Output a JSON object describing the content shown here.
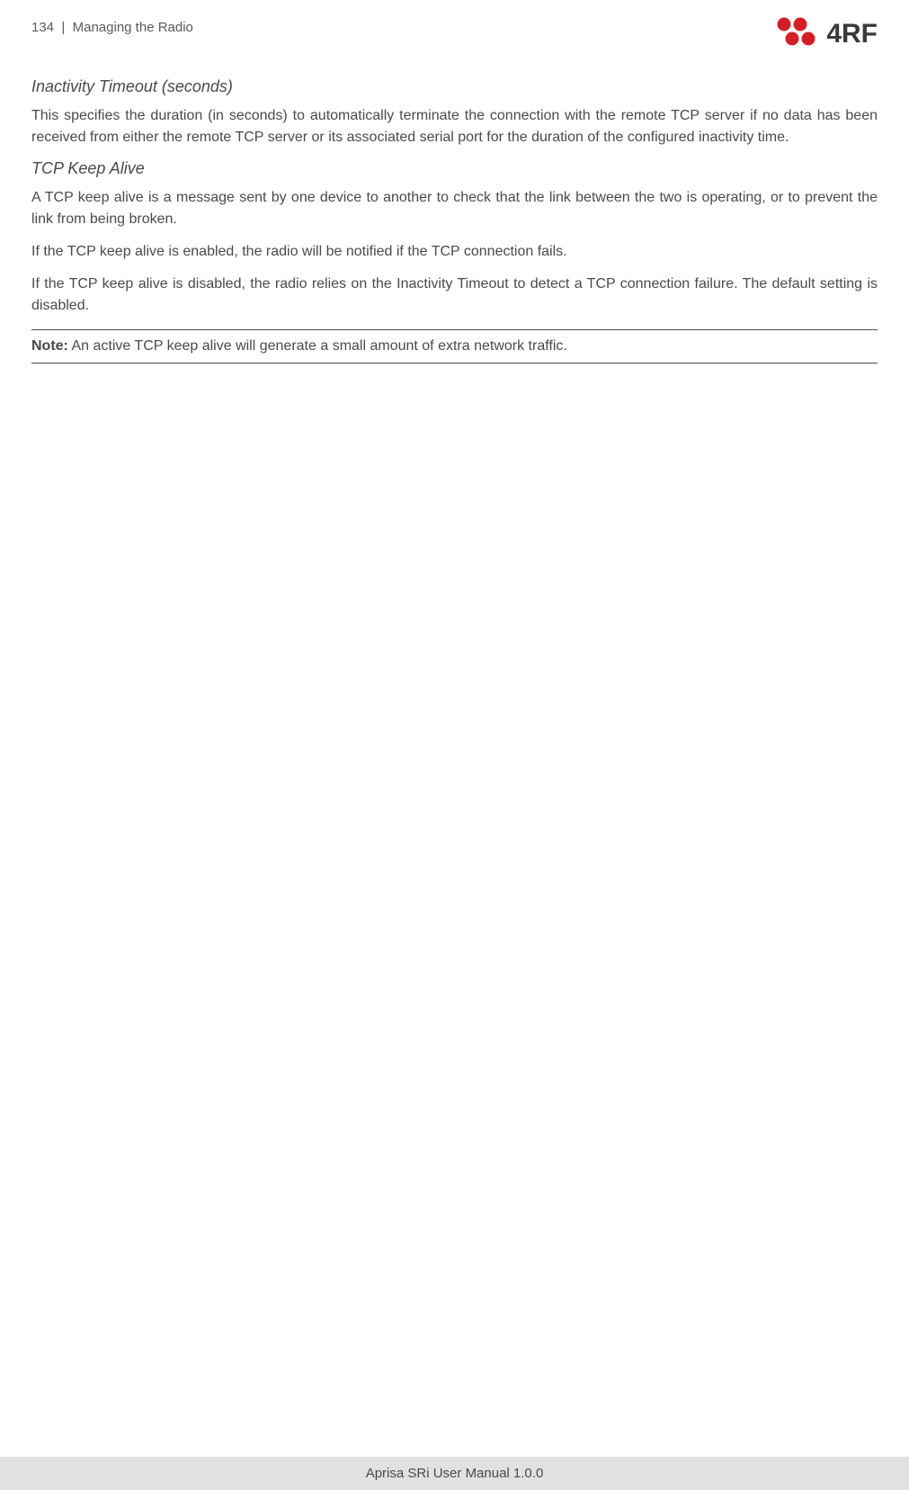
{
  "header": {
    "page_number": "134",
    "separator": "|",
    "section_title": "Managing the Radio",
    "logo_text": "4RF"
  },
  "sections": [
    {
      "heading": "Inactivity Timeout (seconds)",
      "paragraphs": [
        "This specifies the duration (in seconds) to automatically terminate the connection with the remote TCP server if no data has been received from either the remote TCP server or its associated serial port for the duration of the configured inactivity time."
      ]
    },
    {
      "heading": "TCP Keep Alive",
      "paragraphs": [
        "A TCP keep alive is a message sent by one device to another to check that the link between the two is operating, or to prevent the link from being broken.",
        "If the TCP keep alive is enabled, the radio will be notified if the TCP connection fails.",
        "If the TCP keep alive is disabled, the radio relies on the Inactivity Timeout to detect a TCP connection failure. The default setting is disabled."
      ]
    }
  ],
  "note": {
    "label": "Note:",
    "text": "An active TCP keep alive will generate a small amount of extra network traffic."
  },
  "footer": {
    "text": "Aprisa SRi User Manual 1.0.0"
  }
}
